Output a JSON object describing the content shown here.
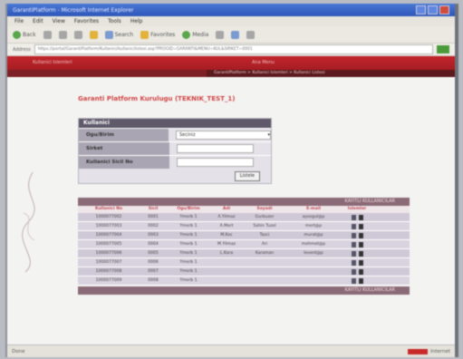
{
  "browser": {
    "title": "GarantiPlatform - Microsoft Internet Explorer",
    "menu": [
      "File",
      "Edit",
      "View",
      "Favorites",
      "Tools",
      "Help"
    ],
    "toolbar": {
      "back": "Back",
      "search": "Search",
      "favorites": "Favorites",
      "media": "Media"
    },
    "address_label": "Address",
    "address_value": "https://portal/GarantiPlatform/Kullanici/kullanicilistesi.asp?PROGID=GARANTI&MENU=KUL&SIRKET=0001",
    "status": "Done",
    "zone": "Internet"
  },
  "app": {
    "top_left": "Kullanici Islemleri",
    "top_center": "Ana Menu",
    "nav_path": "GarantiPlatform > Kullanici Islemleri > Kullanici Listesi",
    "page_title": "Garanti Platform Kurulugu (TEKNIK_TEST_1)",
    "search": {
      "header": "Kullanici",
      "fields": [
        {
          "label": "Ogu/Birim",
          "value": "Seciniz"
        },
        {
          "label": "Sirket",
          "value": ""
        },
        {
          "label": "Kullanici Sicil No",
          "value": ""
        }
      ],
      "button": "Listele"
    },
    "table": {
      "top_caption": "KAYITLI KULLANICILAR",
      "footer_caption": "KAYITLI KULLANICILAR",
      "headers": [
        "Kullanici No",
        "Sicil",
        "Ogu/Birim",
        "Adi",
        "Soyadi",
        "E-mail",
        "Islemler"
      ],
      "rows": [
        [
          "1000077002",
          "0001",
          "Ymerb 1",
          "A.Yilmaz",
          "Gurbuzer",
          "aysegul@p",
          ""
        ],
        [
          "1000077003",
          "0002",
          "Ymerb 1",
          "A.Mert",
          "Sahin Tuzel",
          "mert@p",
          ""
        ],
        [
          "1000077004",
          "0003",
          "Ymerb 1",
          "M.Koc",
          "Tasci",
          "murat@p",
          ""
        ],
        [
          "1000077005",
          "0004",
          "Ymerb 1",
          "M.Yilmaz",
          "Ari",
          "mehmet@p",
          ""
        ],
        [
          "1000077006",
          "0005",
          "Ymerb 1",
          "L.Kara",
          "Karaman",
          "levent@p",
          ""
        ],
        [
          "1000077007",
          "0006",
          "Ymerb 1",
          "",
          "",
          "",
          ""
        ],
        [
          "1000077008",
          "0007",
          "Ymerb 1",
          "",
          "",
          "",
          ""
        ],
        [
          "1000077009",
          "0008",
          "Ymerb 1",
          "",
          "",
          "",
          ""
        ]
      ]
    }
  },
  "colors": {
    "brand_red": "#c2262c",
    "panel_header": "#5f596a",
    "table_header": "#8a6a76",
    "title_red": "#d04646"
  }
}
